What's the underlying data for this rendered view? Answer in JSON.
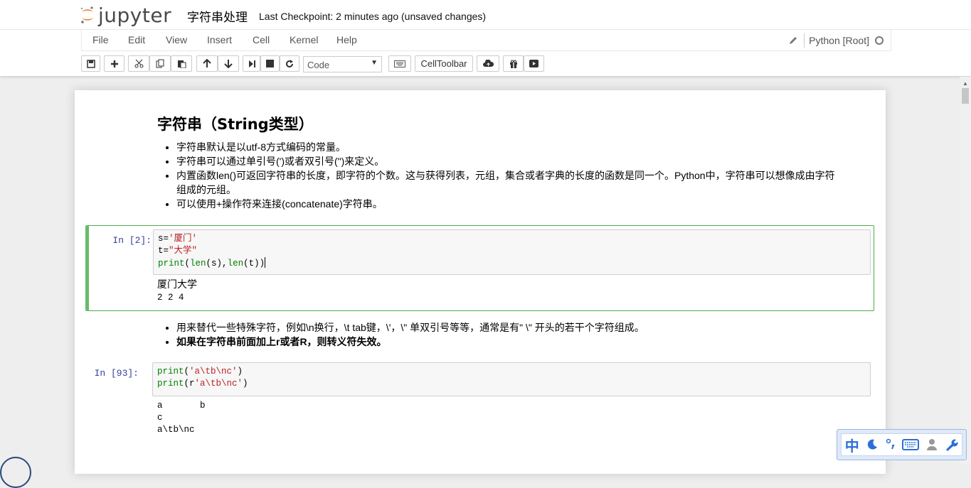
{
  "header": {
    "logo_text": "jupyter",
    "notebook_name": "字符串处理",
    "checkpoint": "Last Checkpoint: 2 minutes ago (unsaved changes)"
  },
  "menu": {
    "items": [
      "File",
      "Edit",
      "View",
      "Insert",
      "Cell",
      "Kernel",
      "Help"
    ],
    "kernel_name": "Python [Root]"
  },
  "toolbar": {
    "cell_type": "Code",
    "celltoolbar_label": "CellToolbar"
  },
  "notebook": {
    "md1": {
      "heading": "字符串（String类型）",
      "bullets": [
        "字符串默认是以utf-8方式编码的常量。",
        "字符串可以通过单引号(')或者双引号(\")来定义。",
        "内置函数len()可返回字符串的长度，即字符的个数。这与获得列表，元组，集合或者字典的长度的函数是同一个。Python中，字符串可以想像成由字符",
        "组成的元组。",
        "可以使用+操作符来连接(concatenate)字符串。"
      ]
    },
    "cell1": {
      "prompt": "In  [2]:",
      "code": {
        "l1_a": "s=",
        "l1_b": "'厦门'",
        "l2_a": "t=",
        "l2_b": "\"大学\"",
        "l3_a": "print",
        "l3_b": "(",
        "l3_c": "len",
        "l3_d": "(s),",
        "l3_e": "len",
        "l3_f": "(t))"
      },
      "output": [
        "厦门大学",
        "2 2 4"
      ]
    },
    "md2": {
      "bullets": [
        "用来替代一些特殊字符，例如\\n换行，\\t tab键，\\'，\\\" 单双引号等等，通常是有\" \\\" 开头的若干个字符组成。",
        "如果在字符串前面加上r或者R，则转义符失效。"
      ]
    },
    "cell2": {
      "prompt": "In  [93]:",
      "code": {
        "l1_a": "print",
        "l1_b": "(",
        "l1_c": "'a\\tb\\nc'",
        "l1_d": ")",
        "l2_a": "print",
        "l2_b": "(r",
        "l2_c": "'a\\tb\\nc'",
        "l2_d": ")"
      },
      "output": [
        "a       b",
        "c",
        "a\\tb\\nc"
      ]
    }
  },
  "ime": {
    "label": "中"
  }
}
